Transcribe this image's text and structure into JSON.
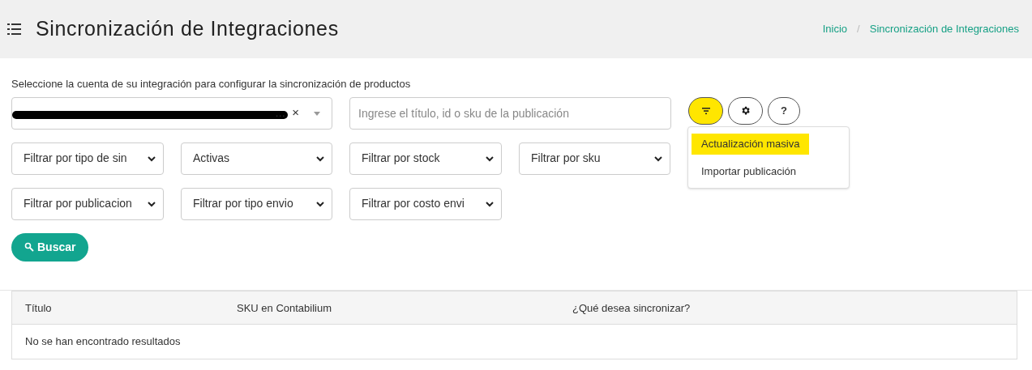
{
  "header": {
    "title": "Sincronización de Integraciones",
    "breadcrumb": [
      {
        "label": "Inicio"
      },
      {
        "label": "Sincronización de Integraciones"
      }
    ],
    "separator": "/"
  },
  "account": {
    "label": "Seleccione la cuenta de su integración para configurar la sincronización de productos",
    "value": "…",
    "redacted": true,
    "clear": "×"
  },
  "search": {
    "placeholder": "Ingrese el título, id o sku de la publicación"
  },
  "actions": [
    {
      "kind": "filter",
      "highlighted": true
    },
    {
      "kind": "settings",
      "highlighted": false
    },
    {
      "kind": "help",
      "label": "?",
      "highlighted": false
    }
  ],
  "menu": [
    {
      "label": "Actualización masiva",
      "highlighted": true
    },
    {
      "label": "Importar publicación",
      "highlighted": false
    }
  ],
  "filters": [
    {
      "value": "Filtrar por tipo de sin"
    },
    {
      "value": "Activas"
    },
    {
      "value": "Filtrar por stock"
    },
    {
      "value": "Filtrar por sku"
    },
    {
      "value": "Filtrar por publicacion"
    },
    {
      "value": "Filtrar por tipo envio"
    },
    {
      "value": "Filtrar por costo envi"
    }
  ],
  "search_button": "Buscar",
  "table": {
    "columns": [
      "Título",
      "SKU en Contabilium",
      "¿Qué desea sincronizar?"
    ],
    "empty": "No se han encontrado resultados"
  }
}
